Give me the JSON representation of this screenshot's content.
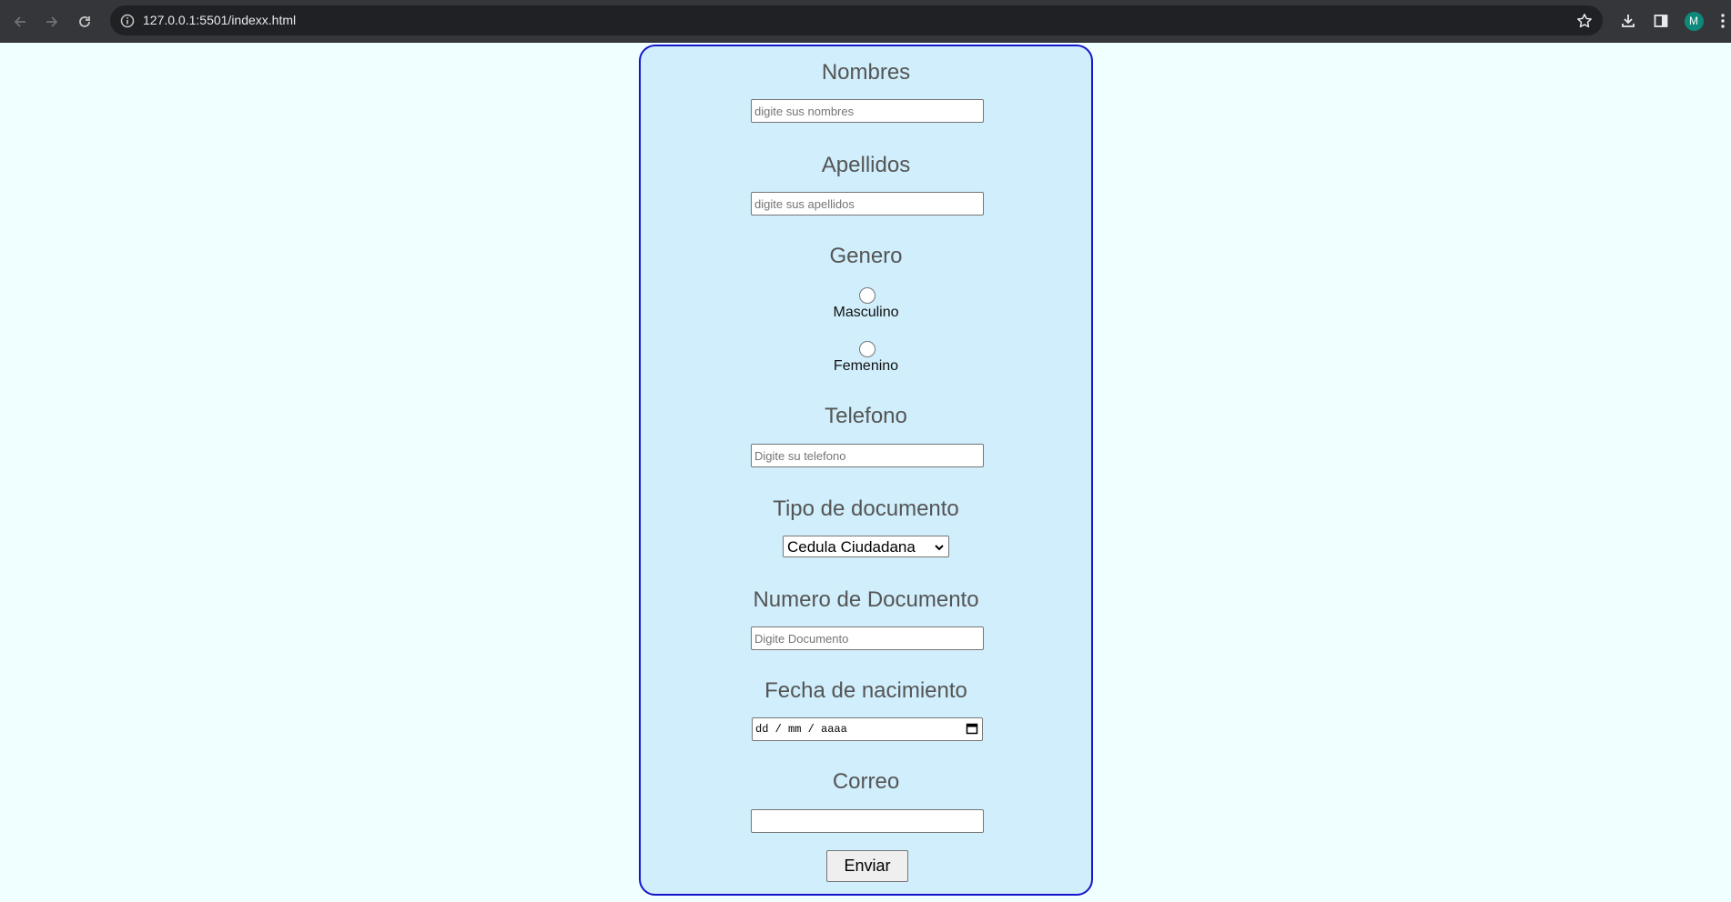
{
  "browser": {
    "url_host": "127.0.0.1",
    "url_rest": ":5501/indexx.html",
    "profile_initial": "M"
  },
  "form": {
    "nombres": {
      "label": "Nombres",
      "placeholder": "digite sus nombres",
      "value": ""
    },
    "apellidos": {
      "label": "Apellidos",
      "placeholder": "digite sus apellidos",
      "value": ""
    },
    "genero": {
      "label": "Genero",
      "options": [
        "Masculino",
        "Femenino"
      ]
    },
    "telefono": {
      "label": "Telefono",
      "placeholder": "Digite su telefono",
      "value": ""
    },
    "tipo_documento": {
      "label": "Tipo de documento",
      "selected": "Cedula Ciudadana"
    },
    "numero_documento": {
      "label": "Numero de Documento",
      "placeholder": "Digite Documento",
      "value": ""
    },
    "fecha_nacimiento": {
      "label": "Fecha de nacimiento",
      "placeholder": "dd / mm / aaaa"
    },
    "correo": {
      "label": "Correo",
      "value": ""
    },
    "submit_label": "Enviar"
  },
  "colors": {
    "page_background": "#f0ffff",
    "card_background": "#d0eefb",
    "card_border": "#1515cc",
    "label_text": "#555555",
    "browser_frame": "#35363a"
  }
}
